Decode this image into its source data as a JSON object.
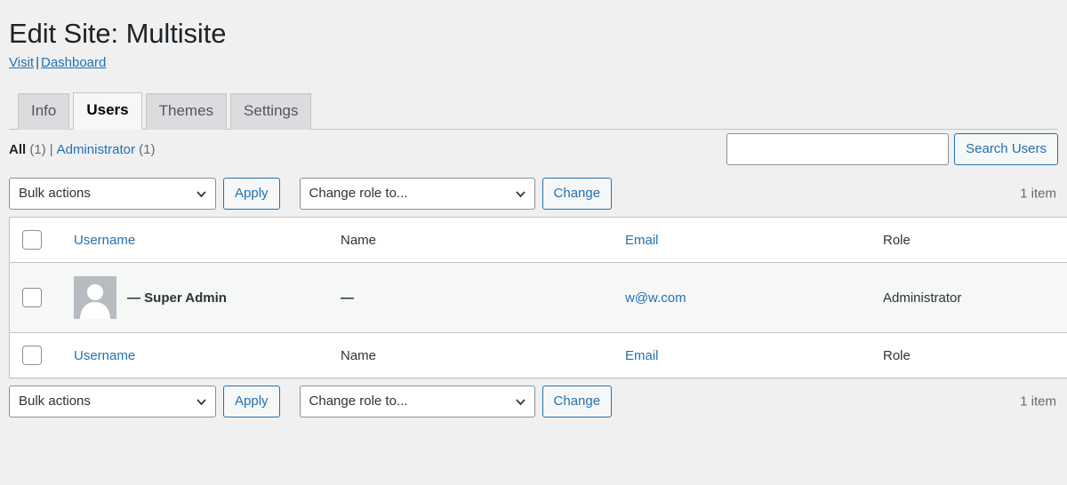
{
  "header": {
    "title": "Edit Site: Multisite",
    "links": [
      {
        "label": "Visit",
        "name": "visit-link"
      },
      {
        "label": "Dashboard",
        "name": "dashboard-link"
      }
    ],
    "separator": "|"
  },
  "tabs": [
    {
      "label": "Info",
      "active": false
    },
    {
      "label": "Users",
      "active": true
    },
    {
      "label": "Themes",
      "active": false
    },
    {
      "label": "Settings",
      "active": false
    }
  ],
  "filters": {
    "all_label": "All",
    "all_count": "(1)",
    "divider": "|",
    "admin_label": "Administrator",
    "admin_count": "(1)"
  },
  "search": {
    "value": "",
    "placeholder": "",
    "button_label": "Search Users"
  },
  "tablenav_top": {
    "bulk_select_value": "Bulk actions",
    "apply_label": "Apply",
    "role_select_value": "Change role to...",
    "change_label": "Change",
    "displaying_num": "1 item"
  },
  "tablenav_bottom": {
    "bulk_select_value": "Bulk actions",
    "apply_label": "Apply",
    "role_select_value": "Change role to...",
    "change_label": "Change",
    "displaying_num": "1 item"
  },
  "table": {
    "columns": {
      "username": "Username",
      "name": "Name",
      "email": "Email",
      "role": "Role"
    },
    "rows": [
      {
        "username": "— Super Admin",
        "name": "—",
        "email": "w@w.com",
        "role": "Administrator"
      }
    ]
  },
  "colors": {
    "accent_link": "#2271b1",
    "page_bg": "#f0f0f1",
    "row_bg": "#f6f7f7",
    "border": "#c3c4c7",
    "text": "#2c3338"
  }
}
